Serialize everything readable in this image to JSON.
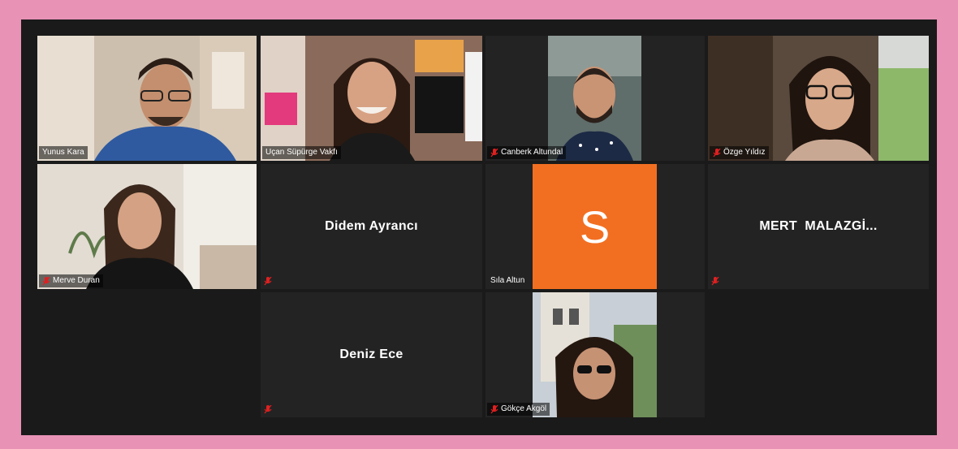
{
  "meeting": {
    "participants": [
      {
        "name": "Yunus Kara"
      },
      {
        "name": "Uçan Süpürge Vakfı"
      },
      {
        "name": "Canberk Altundal"
      },
      {
        "name": "Özge Yıldız"
      },
      {
        "name": "Merve Duran"
      },
      {
        "name": "Didem Ayrancı"
      },
      {
        "name": "Sıla Altun",
        "avatar_letter": "S"
      },
      {
        "name": "MERT  MALAZGİ..."
      },
      {
        "name": "Deniz Ece"
      },
      {
        "name": "Gökçe Akgöl"
      }
    ]
  },
  "colors": {
    "frame": "#e892b6",
    "speaking_border": "#d6e35a",
    "avatar_orange": "#f26f21",
    "mic_muted_red": "#e02020"
  }
}
